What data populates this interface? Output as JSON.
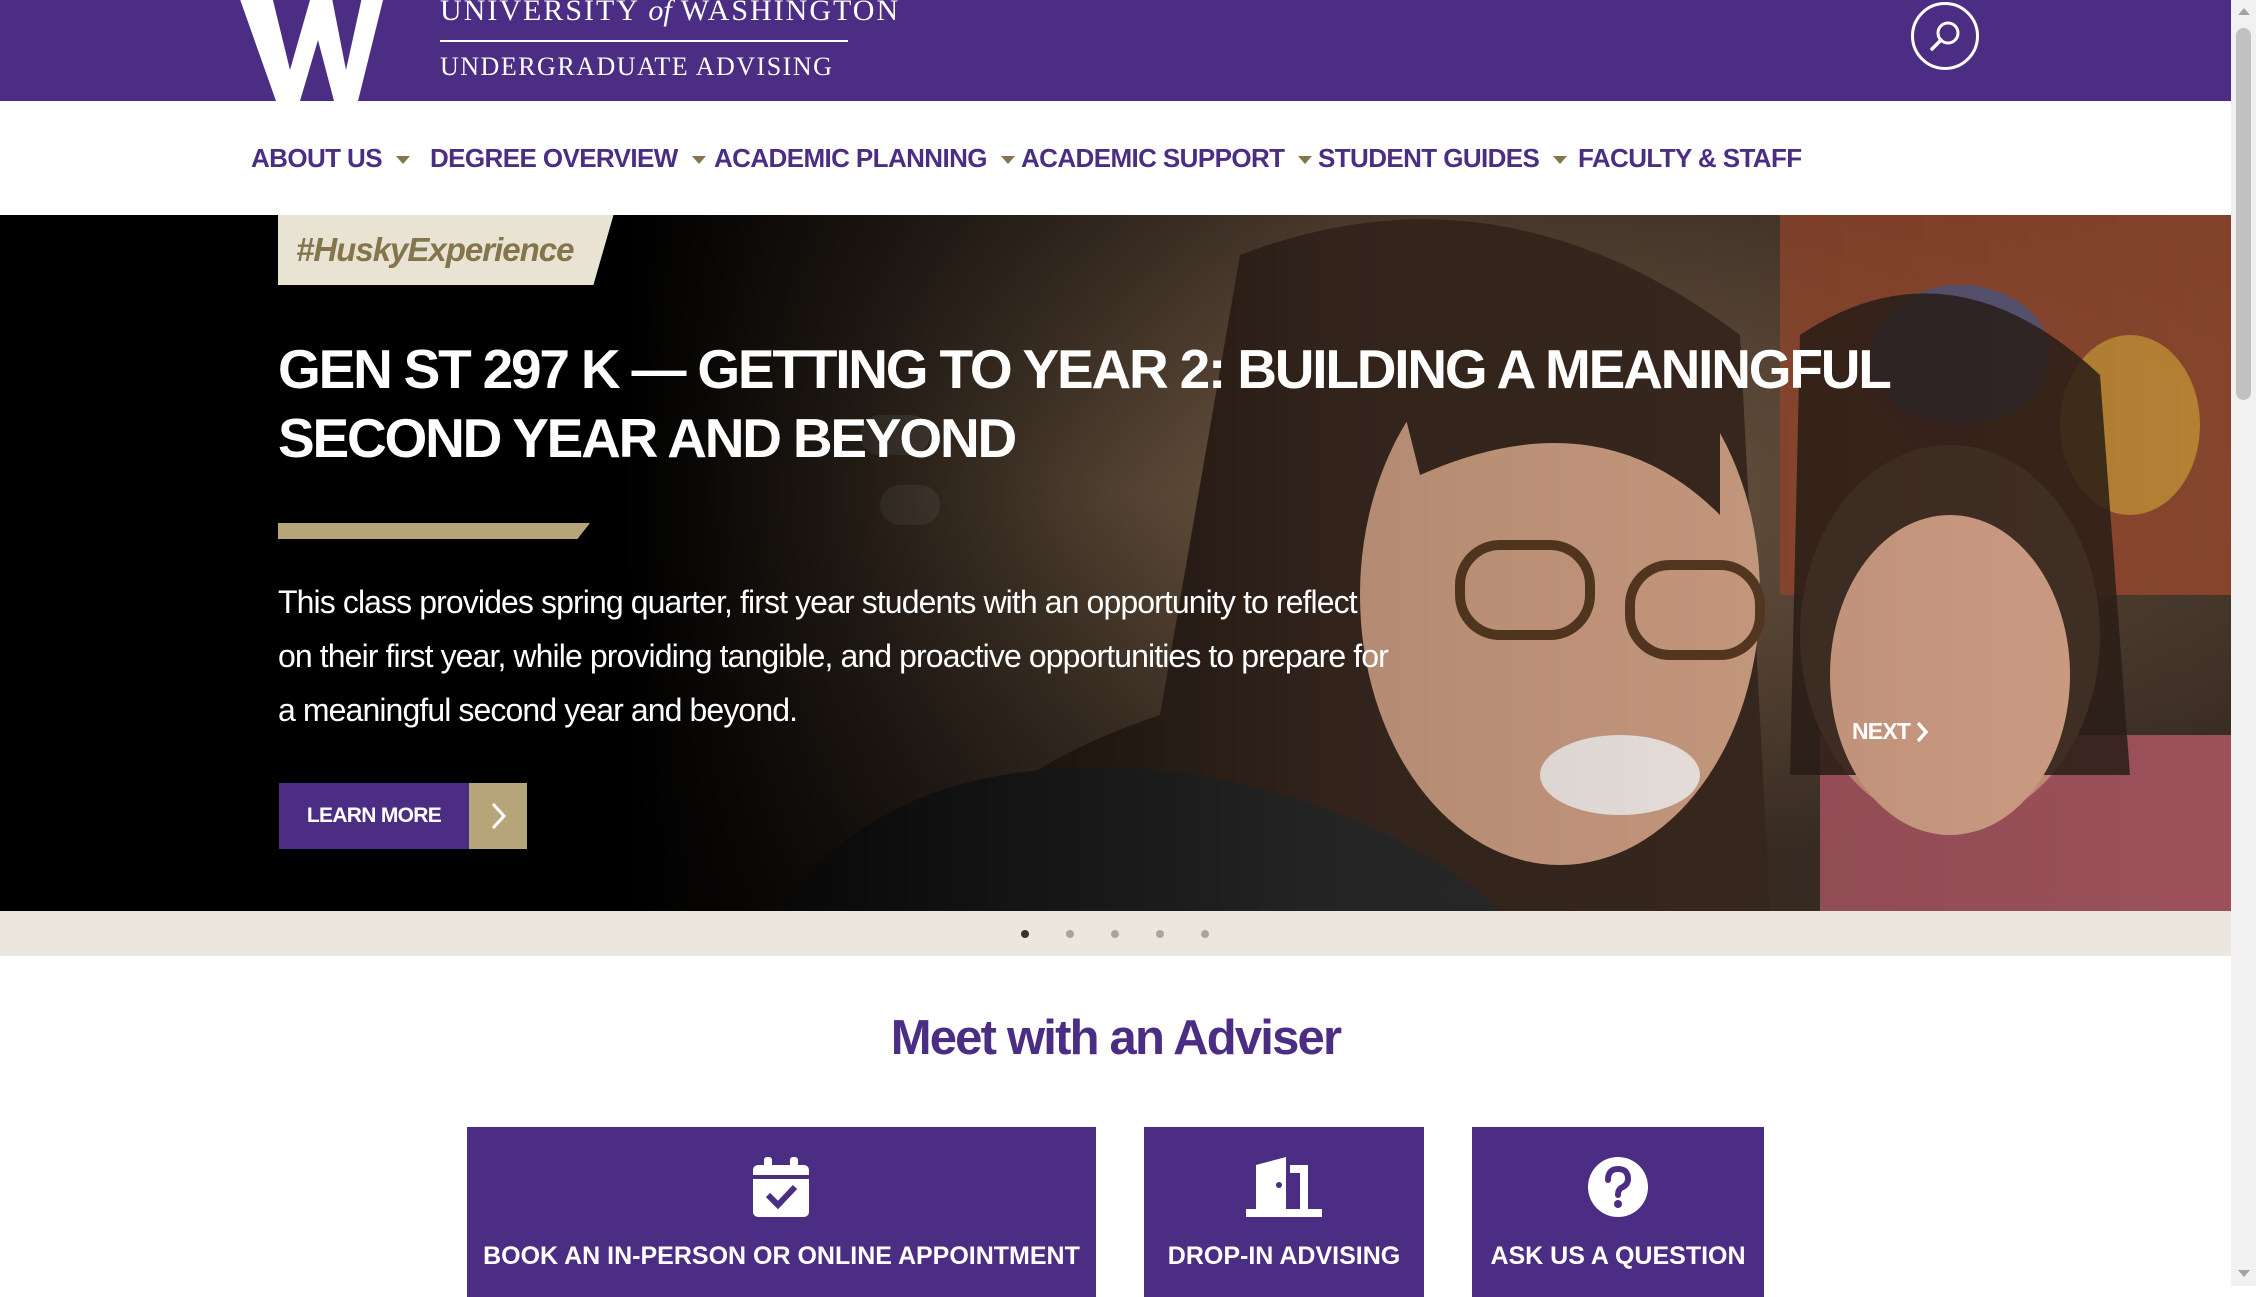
{
  "header": {
    "wordmark_line1_a": "UNIVERSITY",
    "wordmark_line1_of": "of",
    "wordmark_line1_b": "WASHINGTON",
    "wordmark_line2": "UNDERGRADUATE ADVISING",
    "logo_icon": "w-logo",
    "search_icon": "search-icon"
  },
  "nav": {
    "items": [
      {
        "label": "ABOUT US",
        "has_dropdown": true
      },
      {
        "label": "DEGREE OVERVIEW",
        "has_dropdown": true
      },
      {
        "label": "ACADEMIC PLANNING",
        "has_dropdown": true
      },
      {
        "label": "ACADEMIC SUPPORT",
        "has_dropdown": true
      },
      {
        "label": "STUDENT GUIDES",
        "has_dropdown": true
      },
      {
        "label": "FACULTY & STAFF",
        "has_dropdown": false
      }
    ]
  },
  "hero": {
    "tag": "#HuskyExperience",
    "title": "GEN ST 297 K — GETTING TO YEAR 2: BUILDING A MEANINGFUL SECOND YEAR AND BEYOND",
    "description": "This class provides spring quarter, first year students with an opportunity to reflect on their first year, while providing tangible, and proactive opportunities to prepare for a meaningful second year and beyond.",
    "cta_label": "LEARN MORE",
    "next_label": "NEXT"
  },
  "slider": {
    "slide_count": 5,
    "active_index": 0
  },
  "meet": {
    "title": "Meet with an Adviser",
    "cards": [
      {
        "label": "BOOK AN IN-PERSON OR ONLINE APPOINTMENT",
        "icon": "calendar-check-icon"
      },
      {
        "label": "DROP-IN ADVISING",
        "icon": "door-open-icon"
      },
      {
        "label": "ASK US A QUESTION",
        "icon": "question-circle-icon"
      }
    ]
  },
  "colors": {
    "uw_purple": "#4b2e83",
    "uw_gold": "#b7a57a",
    "metallic_gold": "#85754d",
    "dots_band": "#ebe7df"
  }
}
